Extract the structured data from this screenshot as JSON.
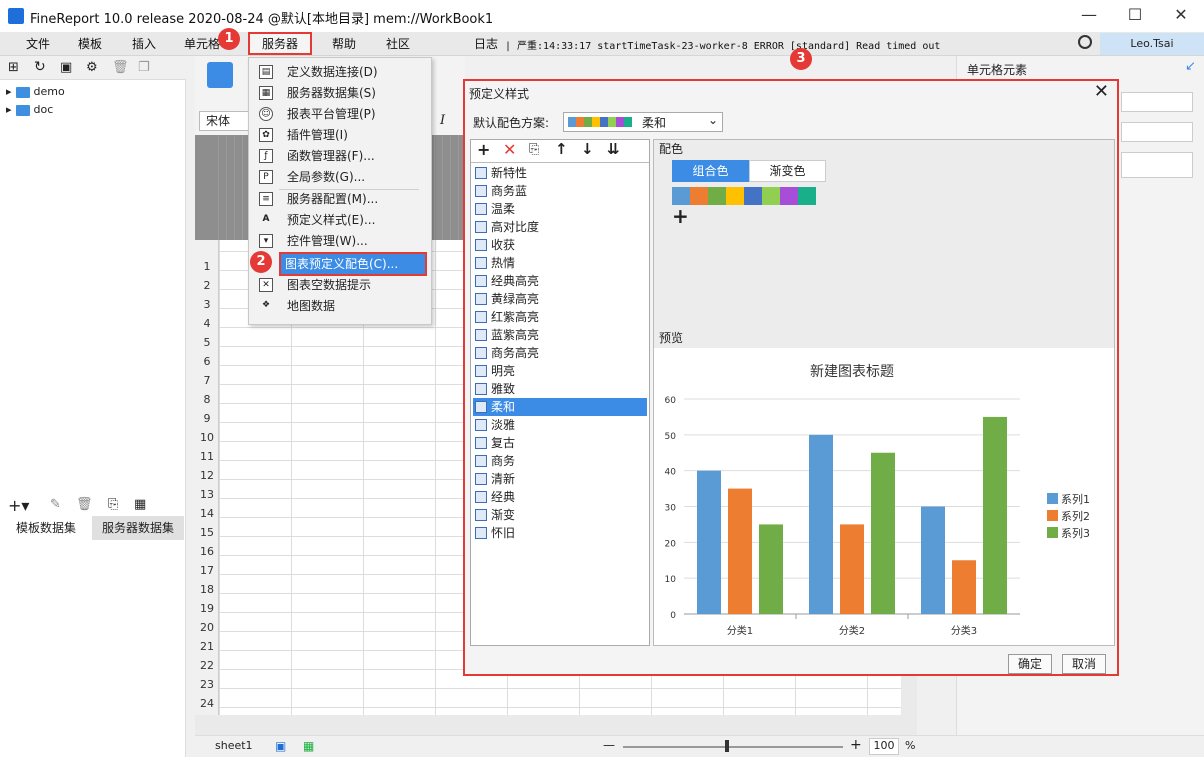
{
  "window": {
    "title": "FineReport 10.0 release 2020-08-24 @默认[本地目录]    mem://WorkBook1",
    "min": "—",
    "max": "☐",
    "close": "✕"
  },
  "menu": {
    "items": [
      "文件",
      "模板",
      "插入",
      "单元格",
      "服务器",
      "帮助",
      "社区"
    ]
  },
  "log": {
    "label": "日志",
    "text": "| 严重:14:33:17 startTimeTask-23-worker-8 ERROR [standard] Read timed out"
  },
  "user": "Leo.Tsai",
  "tree": {
    "items": [
      "demo",
      "doc"
    ]
  },
  "datatabs": [
    "模板数据集",
    "服务器数据集"
  ],
  "font": {
    "name": "宋体",
    "italic": "I"
  },
  "rows": [
    "1",
    "2",
    "3",
    "4",
    "5",
    "6",
    "7",
    "8",
    "9",
    "10",
    "11",
    "12",
    "13",
    "14",
    "15",
    "16",
    "17",
    "18",
    "19",
    "20",
    "21",
    "22",
    "23",
    "24"
  ],
  "sheet": "sheet1",
  "zoom": {
    "value": "100",
    "unit": "%",
    "minus": "—",
    "plus": "+"
  },
  "rightpanel": {
    "title": "单元格元素"
  },
  "server_menu": {
    "items": [
      "定义数据连接(D)",
      "服务器数据集(S)",
      "报表平台管理(P)",
      "插件管理(I)",
      "函数管理器(F)...",
      "全局参数(G)...",
      "服务器配置(M)...",
      "预定义样式(E)...",
      "控件管理(W)...",
      "图表预定义配色(C)...",
      "图表空数据提示",
      "地图数据"
    ]
  },
  "badges": [
    "1",
    "2",
    "3"
  ],
  "dialog": {
    "title": "预定义样式",
    "scheme_label": "默认配色方案:",
    "scheme_value": "柔和",
    "color_section": "配色",
    "tabs": [
      "组合色",
      "渐变色"
    ],
    "preview_label": "预览",
    "styles": [
      "新特性",
      "商务蓝",
      "温柔",
      "高对比度",
      "收获",
      "热情",
      "经典高亮",
      "黄绿高亮",
      "红紫高亮",
      "蓝紫高亮",
      "商务高亮",
      "明亮",
      "雅致",
      "柔和",
      "淡雅",
      "复古",
      "商务",
      "清新",
      "经典",
      "渐变",
      "怀旧"
    ],
    "selected_style": "柔和",
    "palette": [
      "#5b9bd5",
      "#ed7d31",
      "#70ad47",
      "#ffc000",
      "#4472c4",
      "#91cf50",
      "#a64ed8",
      "#1aaf8b"
    ],
    "ok": "确定",
    "cancel": "取消"
  },
  "chart_data": {
    "type": "bar",
    "title": "新建图表标题",
    "categories": [
      "分类1",
      "分类2",
      "分类3"
    ],
    "series": [
      {
        "name": "系列1",
        "values": [
          40,
          50,
          30
        ],
        "color": "#5b9bd5"
      },
      {
        "name": "系列2",
        "values": [
          35,
          25,
          15
        ],
        "color": "#ed7d31"
      },
      {
        "name": "系列3",
        "values": [
          25,
          45,
          55
        ],
        "color": "#70ad47"
      }
    ],
    "yticks": [
      "0",
      "10",
      "20",
      "30",
      "40",
      "50",
      "60"
    ],
    "ylim": [
      0,
      60
    ],
    "legend": "right",
    "grid": true
  }
}
